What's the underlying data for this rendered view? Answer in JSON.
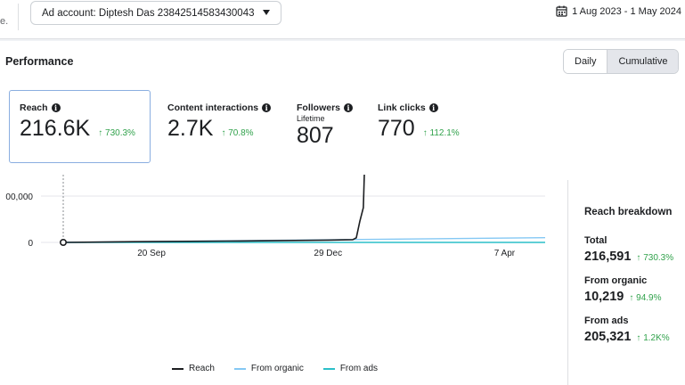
{
  "topbar": {
    "cut_text": "e.",
    "ad_account": "Ad account: Diptesh Das 23842514583430043",
    "date_range": "1 Aug 2023 - 1 May 2024",
    "icons": [
      "calendar-icon",
      "dropdown-caret-icon"
    ]
  },
  "performance": {
    "title": "Performance",
    "toggle": {
      "daily": "Daily",
      "cumulative": "Cumulative",
      "selected": "Cumulative"
    }
  },
  "metrics": [
    {
      "label": "Reach",
      "value": "216.6K",
      "change": "↑ 730.3%",
      "sub": ""
    },
    {
      "label": "Content interactions",
      "value": "2.7K",
      "change": "↑ 70.8%",
      "sub": ""
    },
    {
      "label": "Followers",
      "value": "807",
      "change": "",
      "sub": "Lifetime"
    },
    {
      "label": "Link clicks",
      "value": "770",
      "change": "↑ 112.1%",
      "sub": ""
    }
  ],
  "breakdown": {
    "title": "Reach breakdown",
    "rows": [
      {
        "label": "Total",
        "value": "216,591",
        "change": "↑ 730.3%"
      },
      {
        "label": "From organic",
        "value": "10,219",
        "change": "↑ 94.9%"
      },
      {
        "label": "From ads",
        "value": "205,321",
        "change": "↑ 1.2K%"
      }
    ]
  },
  "colors": {
    "accent": "#1877f2",
    "positive": "#31a24c",
    "reach": "#1c1e21",
    "organic": "#84c8f4",
    "ads": "#2bbfc9",
    "selected_border": "#8aaee0"
  },
  "chart_data": {
    "type": "line",
    "y_tick_labels": [
      "00,000",
      "00,000",
      "00,000",
      "0"
    ],
    "x_tick_labels": [
      "20 Sep",
      "29 Dec",
      "7 Apr"
    ],
    "x_ticks": [
      50,
      150,
      250
    ],
    "x_range": [
      0,
      273
    ],
    "y_range": [
      0,
      300000
    ],
    "grid": true,
    "legend_position": "bottom",
    "series": [
      {
        "name": "Reach",
        "color": "#1c1e21",
        "x": [
          0,
          40,
          100,
          150,
          160,
          164,
          166,
          168,
          170,
          170.5,
          171,
          176,
          180,
          185,
          190,
          200,
          210,
          230,
          260,
          273
        ],
        "y": [
          0,
          1500,
          3000,
          5000,
          5500,
          5800,
          10000,
          45000,
          75000,
          140000,
          200000,
          200500,
          201000,
          201500,
          206000,
          208500,
          211000,
          211500,
          213000,
          216591
        ]
      },
      {
        "name": "From organic",
        "color": "#84c8f4",
        "x": [
          0,
          273
        ],
        "y": [
          0,
          10219
        ]
      },
      {
        "name": "From ads",
        "color": "#2bbfc9",
        "x": [
          0,
          273
        ],
        "y": [
          0,
          0
        ]
      }
    ]
  },
  "legend": [
    {
      "name": "Reach",
      "color": "#1c1e21"
    },
    {
      "name": "From organic",
      "color": "#84c8f4"
    },
    {
      "name": "From ads",
      "color": "#2bbfc9"
    }
  ]
}
